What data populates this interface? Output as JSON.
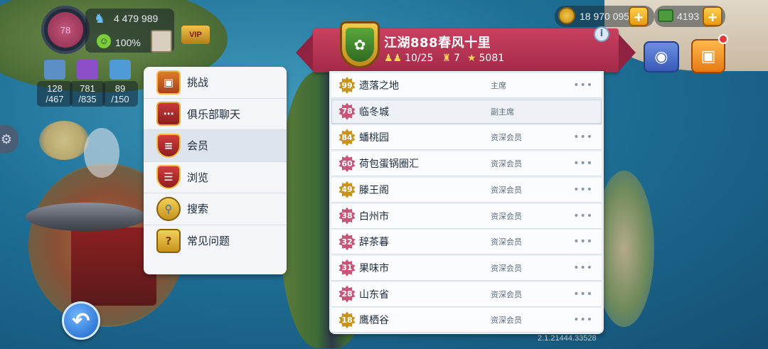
{
  "hud": {
    "level": "78",
    "population": "4 479 989",
    "happiness": "100%",
    "vip": "VIP",
    "coins": "18 970 095",
    "cash": "4193",
    "storage": [
      {
        "value": "128",
        "max": "/467",
        "color": "#5d8fc7"
      },
      {
        "value": "781",
        "max": "/835",
        "color": "#8a4fc7"
      },
      {
        "value": "89",
        "max": "/150",
        "color": "#4f9ad7"
      }
    ],
    "version": "2.1.21444.33528"
  },
  "menu": {
    "items": [
      {
        "label": "挑战",
        "icon": "chest-icon",
        "active": false
      },
      {
        "label": "俱乐部聊天",
        "icon": "chat-icon",
        "active": false
      },
      {
        "label": "会员",
        "icon": "members-icon",
        "active": true
      },
      {
        "label": "浏览",
        "icon": "browse-icon",
        "active": false
      },
      {
        "label": "搜索",
        "icon": "search-icon",
        "active": false
      },
      {
        "label": "常见问题",
        "icon": "faq-icon",
        "active": false
      }
    ]
  },
  "club": {
    "name": "江湖888春风十里",
    "members": "10/25",
    "rank": "7",
    "points": "5081"
  },
  "roster": [
    {
      "level": "99",
      "name": "遗落之地",
      "role": "主席",
      "badge": "gold"
    },
    {
      "level": "78",
      "name": "临冬城",
      "role": "副主席",
      "badge": "pink"
    },
    {
      "level": "84",
      "name": "蟠桃园",
      "role": "资深会员",
      "badge": "gold"
    },
    {
      "level": "60",
      "name": "荷包蛋锅圈汇",
      "role": "资深会员",
      "badge": "pink"
    },
    {
      "level": "49",
      "name": "滕王阁",
      "role": "资深会员",
      "badge": "gold"
    },
    {
      "level": "38",
      "name": "白州市",
      "role": "资深会员",
      "badge": "pink"
    },
    {
      "level": "32",
      "name": "辞茶暮",
      "role": "资深会员",
      "badge": "pink"
    },
    {
      "level": "31",
      "name": "果味市",
      "role": "资深会员",
      "badge": "pink"
    },
    {
      "level": "28",
      "name": "山东省",
      "role": "资深会员",
      "badge": "pink"
    },
    {
      "level": "18",
      "name": "鹰栖谷",
      "role": "资深会员",
      "badge": "gold"
    }
  ]
}
